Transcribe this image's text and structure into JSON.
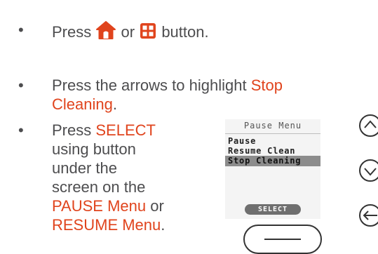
{
  "instructions": {
    "bullet": "•",
    "step1": {
      "press": "Press",
      "or": "or",
      "button": "button."
    },
    "step2": {
      "text": "Press the arrows to highlight",
      "hl1": "Stop",
      "hl2": "Cleaning",
      "end": "."
    },
    "step3": {
      "press": "Press",
      "select": "SELECT",
      "line2": "using button",
      "line3": "under the",
      "line4": "screen on the",
      "pause_menu": "PAUSE Menu",
      "or": "or",
      "resume_menu": "RESUME Menu",
      "end": "."
    }
  },
  "device": {
    "screen_title": "Pause Menu",
    "menu_items": [
      "Pause",
      "Resume Clean",
      "Stop Cleaning"
    ],
    "selected_index": 2,
    "select_label": "SELECT"
  },
  "icons": {
    "home": "home-icon",
    "grid": "grid-icon",
    "up": "chevron-up-icon",
    "down": "chevron-down-icon",
    "back": "back-arrow-icon"
  },
  "colors": {
    "highlight": "#e0441d",
    "text": "#4d4d4f"
  }
}
